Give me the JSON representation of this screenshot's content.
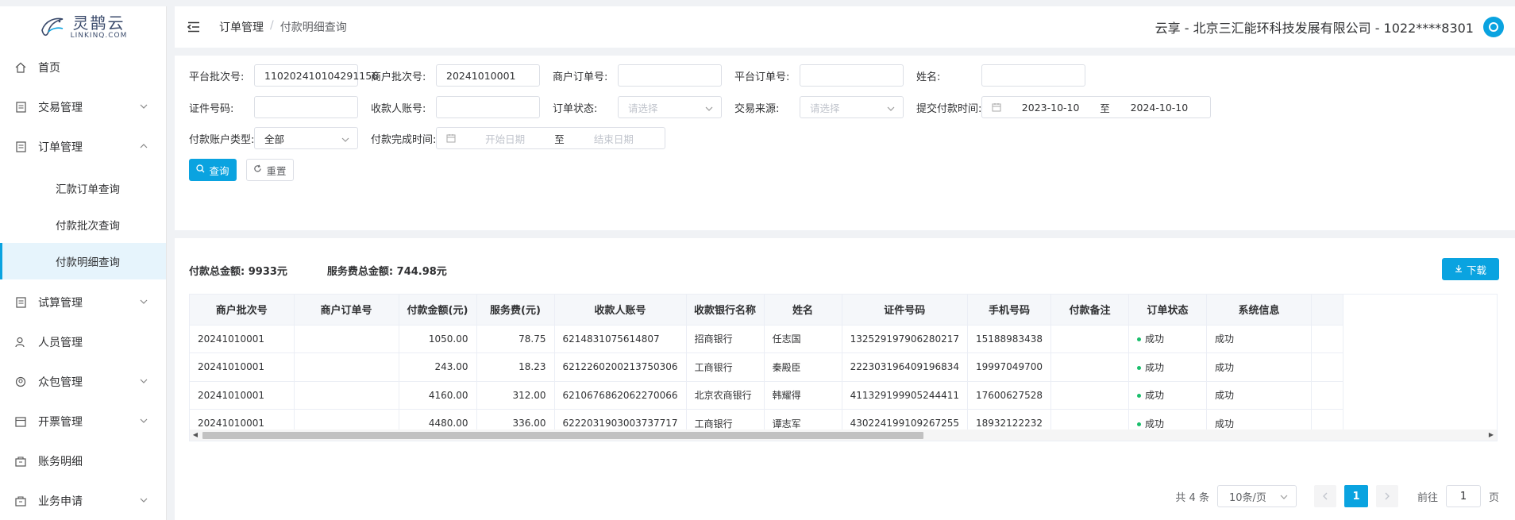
{
  "brand": {
    "name_cn": "灵鹊云",
    "name_en": "LINKINQ.COM"
  },
  "sidebar": {
    "items": [
      {
        "label": "首页",
        "icon": "home-icon"
      },
      {
        "label": "交易管理",
        "icon": "document-icon"
      },
      {
        "label": "订单管理",
        "icon": "document-icon"
      },
      {
        "label": "试算管理",
        "icon": "document-icon"
      },
      {
        "label": "人员管理",
        "icon": "user-icon"
      },
      {
        "label": "众包管理",
        "icon": "crowd-icon"
      },
      {
        "label": "开票管理",
        "icon": "invoice-icon"
      },
      {
        "label": "账务明细",
        "icon": "ledger-icon"
      },
      {
        "label": "业务申请",
        "icon": "ledger-icon"
      }
    ],
    "order_submenu": [
      {
        "label": "汇款订单查询"
      },
      {
        "label": "付款批次查询"
      },
      {
        "label": "付款明细查询",
        "active": true
      }
    ]
  },
  "header": {
    "breadcrumb": [
      "订单管理",
      "付款明细查询"
    ],
    "breadcrumb_sep": "/",
    "company": "云享 - 北京三汇能环科技发展有限公司 - 1022****8301"
  },
  "filters": {
    "platform_batch_label": "平台批次号:",
    "platform_batch_value": "110202410104291156",
    "merchant_batch_label": "商户批次号:",
    "merchant_batch_value": "20241010001",
    "merchant_order_label": "商户订单号:",
    "platform_order_label": "平台订单号:",
    "name_label": "姓名:",
    "id_number_label": "证件号码:",
    "payee_account_label": "收款人账号:",
    "order_status_label": "订单状态:",
    "order_status_placeholder": "请选择",
    "source_label": "交易来源:",
    "source_placeholder": "请选择",
    "submit_time_label": "提交付款时间:",
    "submit_start": "2023-10-10",
    "submit_end": "2024-10-10",
    "range_sep": "至",
    "account_type_label": "付款账户类型:",
    "account_type_value": "全部",
    "finish_time_label": "付款完成时间:",
    "finish_start_placeholder": "开始日期",
    "finish_end_placeholder": "结束日期",
    "search_button": "查询",
    "reset_button": "重置"
  },
  "summary": {
    "total_amount": "付款总金额: 9933元",
    "service_total": "服务费总金额: 744.98元",
    "download_button": "下载"
  },
  "table": {
    "columns": [
      "商户批次号",
      "商户订单号",
      "付款金额(元)",
      "服务费(元)",
      "收款人账号",
      "收款银行名称",
      "姓名",
      "证件号码",
      "手机号码",
      "付款备注",
      "订单状态",
      "系统信息"
    ],
    "rows": [
      [
        "20241010001",
        "",
        "1050.00",
        "78.75",
        "6214831075614807",
        "招商银行",
        "任志国",
        "132529197906280217",
        "15188983438",
        "",
        "成功",
        "成功"
      ],
      [
        "20241010001",
        "",
        "243.00",
        "18.23",
        "6212260200213750306",
        "工商银行",
        "秦殿臣",
        "222303196409196834",
        "19997049700",
        "",
        "成功",
        "成功"
      ],
      [
        "20241010001",
        "",
        "4160.00",
        "312.00",
        "6210676862062270066",
        "北京农商银行",
        "韩耀得",
        "411329199905244411",
        "17600627528",
        "",
        "成功",
        "成功"
      ],
      [
        "20241010001",
        "",
        "4480.00",
        "336.00",
        "6222031903003737717",
        "工商银行",
        "谭志军",
        "430224199109267255",
        "18932122232",
        "",
        "成功",
        "成功"
      ]
    ]
  },
  "pagination": {
    "total": "共 4 条",
    "page_size": "10条/页",
    "current_page": "1",
    "goto_label": "前往",
    "goto_value": "1",
    "page_suffix": "页"
  },
  "colors": {
    "accent": "#0aa3e0",
    "success": "#19be6b"
  }
}
